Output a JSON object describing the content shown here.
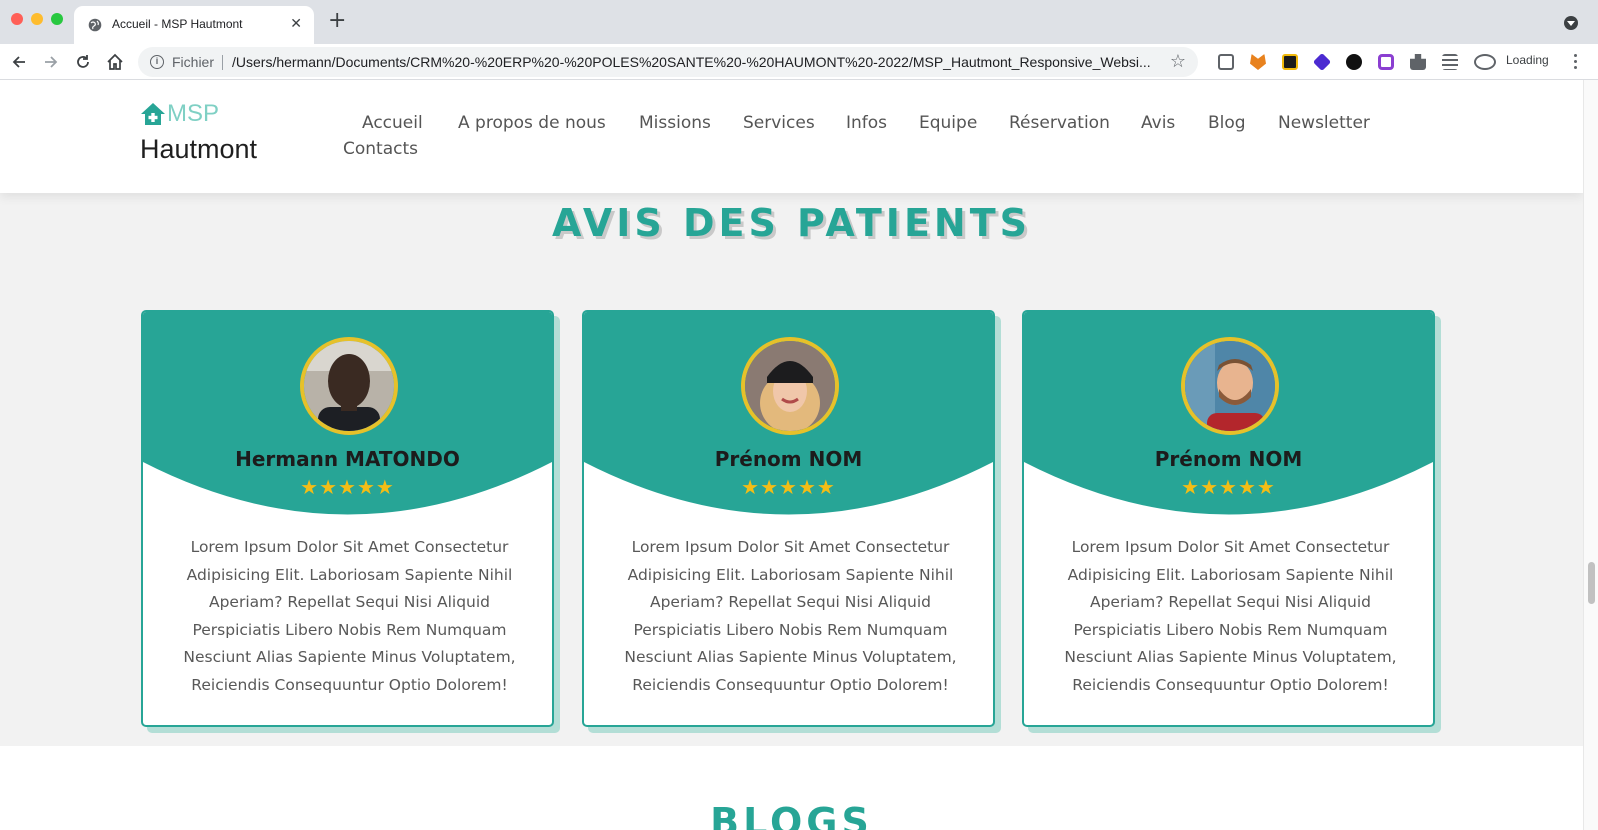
{
  "browser": {
    "tab_title": "Accueil - MSP Hautmont",
    "omnibox_label": "Fichier",
    "url": "/Users/hermann/Documents/CRM%20-%20ERP%20-%20POLES%20SANTE%20-%20HAUMONT%20-2022/MSP_Hautmont_Responsive_Websi...",
    "status_label": "Loading"
  },
  "site": {
    "logo_msp": "MSP",
    "logo_name": "Hautmont",
    "nav": [
      "Accueil",
      "A propos de nous",
      "Missions",
      "Services",
      "Infos",
      "Equipe",
      "Réservation",
      "Avis",
      "Blog",
      "Newsletter",
      "Contacts"
    ]
  },
  "reviews": {
    "title": "AVIS DES PATIENTS",
    "cards": [
      {
        "name": "Hermann MATONDO",
        "stars": "★★★★★",
        "text": "Lorem Ipsum Dolor Sit Amet Consectetur Adipisicing Elit. Laboriosam Sapiente Nihil Aperiam? Repellat Sequi Nisi Aliquid Perspiciatis Libero Nobis Rem Numquam Nesciunt Alias Sapiente Minus Voluptatem, Reiciendis Consequuntur Optio Dolorem!"
      },
      {
        "name": "Prénom NOM",
        "stars": "★★★★★",
        "text": "Lorem Ipsum Dolor Sit Amet Consectetur Adipisicing Elit. Laboriosam Sapiente Nihil Aperiam? Repellat Sequi Nisi Aliquid Perspiciatis Libero Nobis Rem Numquam Nesciunt Alias Sapiente Minus Voluptatem, Reiciendis Consequuntur Optio Dolorem!"
      },
      {
        "name": "Prénom NOM",
        "stars": "★★★★★",
        "text": "Lorem Ipsum Dolor Sit Amet Consectetur Adipisicing Elit. Laboriosam Sapiente Nihil Aperiam? Repellat Sequi Nisi Aliquid Perspiciatis Libero Nobis Rem Numquam Nesciunt Alias Sapiente Minus Voluptatem, Reiciendis Consequuntur Optio Dolorem!"
      }
    ]
  },
  "blogs": {
    "title": "BLOGS"
  },
  "colors": {
    "accent": "#27a596",
    "star": "#f3bd16",
    "avatar_ring": "#e6c12a"
  }
}
